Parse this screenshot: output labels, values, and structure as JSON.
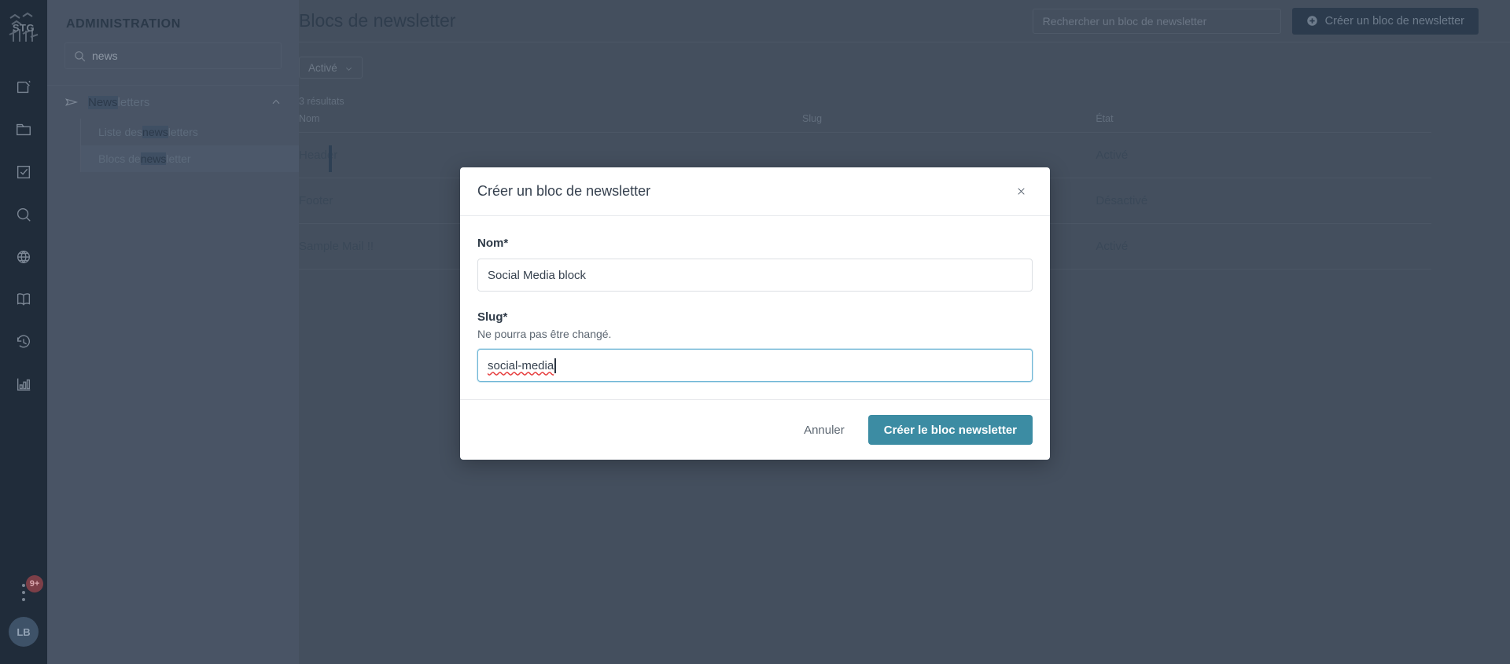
{
  "colors": {
    "rail_bg": "#202c3a",
    "sidebar_bg": "#495465",
    "overlay_bg": "#444f5e",
    "modal_bg": "#ffffff",
    "primary_button": "#3c8ca3",
    "focus_border": "#6fb6d6",
    "spellcheck_underline": "#e63e3e",
    "badge_bg": "#7c3f48"
  },
  "rail": {
    "logo_text": "STG",
    "items": [
      {
        "icon": "compose-icon"
      },
      {
        "icon": "folder-icon"
      },
      {
        "icon": "checkbox-icon"
      },
      {
        "icon": "search-icon"
      },
      {
        "icon": "globe-icon"
      },
      {
        "icon": "book-icon"
      },
      {
        "icon": "history-icon"
      },
      {
        "icon": "bar-chart-icon"
      }
    ],
    "more_icon": "more-vertical-icon",
    "notification_badge": "9+",
    "avatar_initials": "LB"
  },
  "sidebar": {
    "title": "ADMINISTRATION",
    "search": {
      "value": "news",
      "icon": "search-icon"
    },
    "group": {
      "label_highlight": "News",
      "label_rest": "letters",
      "icon": "send-icon",
      "chevron": "chevron-up-icon"
    },
    "sub_items": [
      {
        "prefix": "Liste des ",
        "highlight": "news",
        "suffix": "letters",
        "active": false
      },
      {
        "prefix": "Blocs de ",
        "highlight": "news",
        "suffix": "letter",
        "active": true
      }
    ]
  },
  "main": {
    "page_title": "Blocs de newsletter",
    "search_placeholder": "Rechercher un bloc de newsletter",
    "create_button": "Créer un bloc de newsletter",
    "create_button_icon": "plus-circle-icon",
    "filter_chip": "Activé",
    "filter_chip_icon": "chevron-down-icon",
    "results_count": "3 résultats",
    "table": {
      "headers": [
        "Nom",
        "Slug",
        "État"
      ],
      "rows": [
        {
          "nom": "Header",
          "slug": "",
          "etat": "Activé"
        },
        {
          "nom": "Footer",
          "slug": "",
          "etat": "Désactivé"
        },
        {
          "nom": "Sample Mail !!",
          "slug": "",
          "etat": "Activé"
        }
      ]
    }
  },
  "modal": {
    "title": "Créer un bloc de newsletter",
    "close_icon": "close-icon",
    "name_field": {
      "label": "Nom",
      "required_mark": "*",
      "value": "Social Media block"
    },
    "slug_field": {
      "label": "Slug",
      "required_mark": "*",
      "hint": "Ne pourra pas être changé.",
      "value": "social-media",
      "focused": true
    },
    "cancel_button": "Annuler",
    "submit_button": "Créer le bloc newsletter"
  }
}
